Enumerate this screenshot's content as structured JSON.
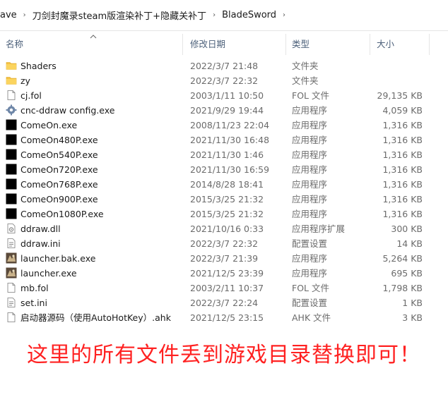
{
  "breadcrumb": {
    "items": [
      "ave",
      "刀剑封魔录steam版渲染补丁+隐藏关补丁",
      "BladeSword"
    ],
    "separator": "›"
  },
  "columns": {
    "name": "名称",
    "date": "修改日期",
    "type": "类型",
    "size": "大小"
  },
  "files": [
    {
      "name": "Shaders",
      "date": "2022/3/7 21:48",
      "type": "文件夹",
      "size": "",
      "icon": "folder-icon"
    },
    {
      "name": "zy",
      "date": "2022/3/7 22:32",
      "type": "文件夹",
      "size": "",
      "icon": "folder-icon"
    },
    {
      "name": "cj.fol",
      "date": "2003/1/11 10:50",
      "type": "FOL 文件",
      "size": "29,135 KB",
      "icon": "file-icon"
    },
    {
      "name": "cnc-ddraw config.exe",
      "date": "2021/9/29 19:44",
      "type": "应用程序",
      "size": "4,059 KB",
      "icon": "gear-app-icon"
    },
    {
      "name": "ComeOn.exe",
      "date": "2008/11/23 22:04",
      "type": "应用程序",
      "size": "1,316 KB",
      "icon": "black-app-icon"
    },
    {
      "name": "ComeOn480P.exe",
      "date": "2021/11/30 16:48",
      "type": "应用程序",
      "size": "1,316 KB",
      "icon": "black-app-icon"
    },
    {
      "name": "ComeOn540P.exe",
      "date": "2021/11/30 1:46",
      "type": "应用程序",
      "size": "1,316 KB",
      "icon": "black-app-icon"
    },
    {
      "name": "ComeOn720P.exe",
      "date": "2021/11/30 16:59",
      "type": "应用程序",
      "size": "1,316 KB",
      "icon": "black-app-icon"
    },
    {
      "name": "ComeOn768P.exe",
      "date": "2014/8/28 18:41",
      "type": "应用程序",
      "size": "1,316 KB",
      "icon": "black-app-icon"
    },
    {
      "name": "ComeOn900P.exe",
      "date": "2015/3/25 21:32",
      "type": "应用程序",
      "size": "1,316 KB",
      "icon": "black-app-icon"
    },
    {
      "name": "ComeOn1080P.exe",
      "date": "2015/3/25 21:32",
      "type": "应用程序",
      "size": "1,316 KB",
      "icon": "black-app-icon"
    },
    {
      "name": "ddraw.dll",
      "date": "2021/10/16 0:33",
      "type": "应用程序扩展",
      "size": "300 KB",
      "icon": "dll-icon"
    },
    {
      "name": "ddraw.ini",
      "date": "2022/3/7 22:32",
      "type": "配置设置",
      "size": "14 KB",
      "icon": "ini-icon"
    },
    {
      "name": "launcher.bak.exe",
      "date": "2022/3/7 21:39",
      "type": "应用程序",
      "size": "5,264 KB",
      "icon": "launcher-icon"
    },
    {
      "name": "launcher.exe",
      "date": "2021/12/5 23:39",
      "type": "应用程序",
      "size": "695 KB",
      "icon": "launcher-icon"
    },
    {
      "name": "mb.fol",
      "date": "2003/2/11 10:37",
      "type": "FOL 文件",
      "size": "1,798 KB",
      "icon": "file-icon"
    },
    {
      "name": "set.ini",
      "date": "2022/3/7 22:24",
      "type": "配置设置",
      "size": "1 KB",
      "icon": "ini-icon"
    },
    {
      "name": "启动器源码（使用AutoHotKey）.ahk",
      "date": "2021/12/5 23:15",
      "type": "AHK 文件",
      "size": "3 KB",
      "icon": "file-icon"
    }
  ],
  "caption": "这里的所有文件丢到游戏目录替换即可！",
  "colors": {
    "caption": "#ff2121",
    "folder": "#f5c244",
    "header_text": "#4c607a"
  }
}
